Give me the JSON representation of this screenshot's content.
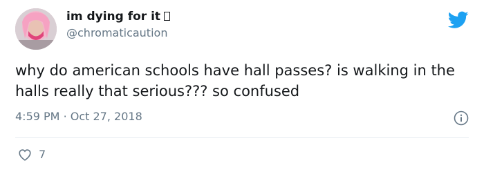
{
  "tweet": {
    "display_name": "im dying for it",
    "handle": "@chromaticaution",
    "text": "why do american schools have hall passes? is walking in the halls really that serious??? so confused",
    "time": "4:59 PM",
    "separator": "·",
    "date": "Oct 27, 2018",
    "like_count": "7"
  },
  "icons": {
    "brand": "twitter-bird-icon",
    "info": "info-icon",
    "like": "heart-icon"
  },
  "colors": {
    "twitter_blue": "#1da1f2",
    "secondary_text": "#657786",
    "primary_text": "#14171a",
    "divider": "#e6ecf0"
  }
}
